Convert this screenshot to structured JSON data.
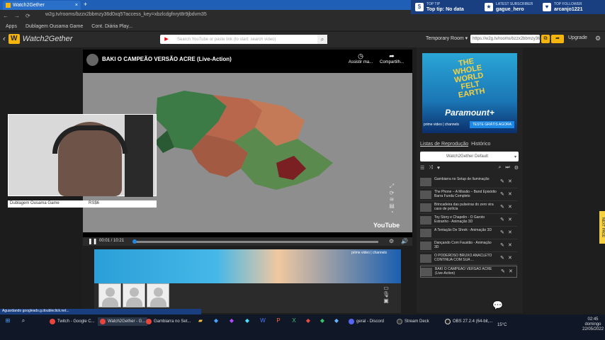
{
  "browser": {
    "tab_title": "Watch2Gether",
    "tab_close": "×",
    "new_tab": "+",
    "url": "w2g.tv/rooms/bzzx2bbmzy36d0xq5?access_key=xbzlcdgfnryt8r9jbdvm35",
    "bookmarks": [
      "Apps",
      "Dublagem Ousama Game",
      "Cont. Diária Play..."
    ],
    "nav": [
      "←",
      "→",
      "⟳"
    ]
  },
  "overlay": {
    "top_tip_label": "TOP TIP",
    "top_tip_value": "Top tip: No data",
    "sub_label": "LATEST SUBSCRIBER",
    "sub_value": "gague_hero",
    "follower_label": "TOP FOLLOWER",
    "follower_value": "arcanjo1221"
  },
  "w2g": {
    "logo": "Watch2Gether",
    "logo_letter": "W",
    "search_placeholder": "Search YouTube or paste link (to start: search video)",
    "search_icon": "search-icon",
    "rooms": "Temporary Room ▾",
    "room_url": "https://w2g.tv/rooms/bzzx2bbmzy36d0xq5",
    "upgrade": "Upgrade",
    "gear": "⚙"
  },
  "video": {
    "title": "BAKI O CAMPEÃO VERSÃO ACRE (Live-Action)",
    "watch_later": "Assistir ma...",
    "share": "Compartilh...",
    "youtube": "YouTube",
    "time": "00:01 / 10:21",
    "progress": 0.002
  },
  "facecam": {
    "name": "Dublagem Ousama Game",
    "tag": "RS$6"
  },
  "ad": {
    "title": "THE WHOLE WORLD FELT EARTH",
    "brand": "Paramount+",
    "prime": "prime video | channels",
    "cta": "TESTE GRÁTIS AGORA"
  },
  "playlist": {
    "tab_lists": "Listas de Reprodução",
    "tab_history": "Histórico",
    "selected": "Watch2Gether Default",
    "items": [
      {
        "title": "Gambiarra no Setup de Iluminação"
      },
      {
        "title": "The Phone – A Missão – Band Episódio Barra Funda Completo"
      },
      {
        "title": "Brincadeira das pulseiras do zero vira caso de polícia"
      },
      {
        "title": "Toy Story e Chapolin - O Garoto Estranho - Animação 3D"
      },
      {
        "title": "A Tentação De Shrek - Animação 3D"
      },
      {
        "title": "Dançando Com Faustão - Animação 3D"
      },
      {
        "title": "O PODEROSO BRUXO ANACLETO CONTINUA COM SUA ..."
      },
      {
        "title": "BAKI O CAMPEÃO VERSÃO ACRE (Live-Action)"
      }
    ]
  },
  "status": "Aguardando googleads.g.doubleclick.net...",
  "taskbar": {
    "items": [
      "Twitch - Google C...",
      "Watch2Gether - G...",
      "Gambiarra no Set...",
      "geral - Discord",
      "Stream Deck",
      "OBS 27.2.4 (64-bit,..."
    ],
    "temp": "15°C",
    "time": "02:45",
    "day": "domingo",
    "date": "22/05/2022"
  },
  "side_badge": "NEXT PAGE",
  "colors": {
    "brand": "#f5b50f",
    "tabbar": "#1f5fb6",
    "accent": "#1e88e5"
  }
}
